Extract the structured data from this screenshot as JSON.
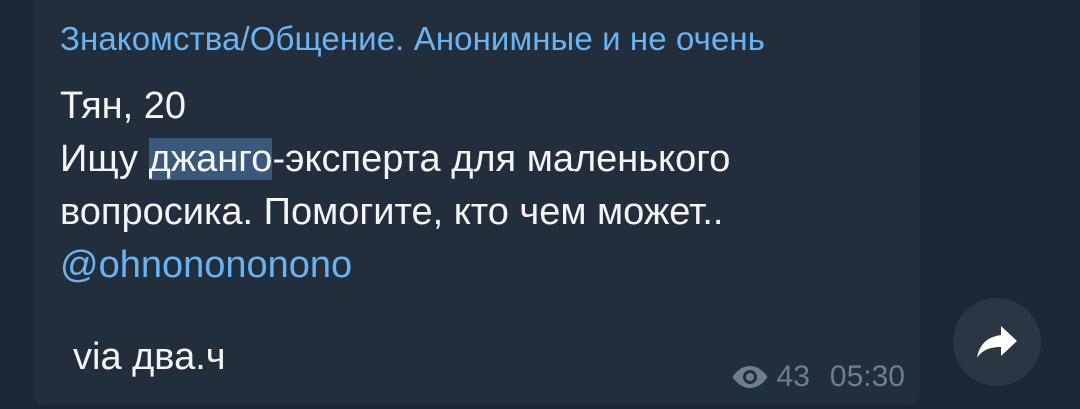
{
  "message": {
    "channel_title": "Знакомства/Общение. Анонимные и не очень",
    "line1": "Тян, 20",
    "line2_prefix": "Ищу ",
    "line2_highlight": "джанго",
    "line2_suffix": "-эксперта для маленького",
    "line3": "вопросика. Помогите, кто чем может..",
    "mention": "@ohnonononono",
    "via": "via два.ч",
    "views": "43",
    "time": "05:30"
  },
  "icons": {
    "views": "eye-icon",
    "share": "share-arrow-icon"
  },
  "colors": {
    "background": "#1d2733",
    "bubble": "#232e3c",
    "accent": "#6ab3f3",
    "text": "#f5f5f5",
    "meta": "#6d7f8f",
    "highlight": "#3a5879"
  }
}
